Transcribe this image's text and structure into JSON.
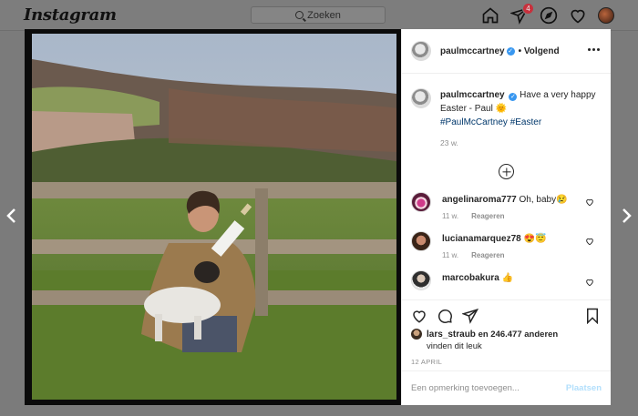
{
  "nav": {
    "logo": "Instagram",
    "search_placeholder": "Zoeken",
    "notification_count": "4",
    "icons": [
      "home-icon",
      "direct-icon",
      "explore-icon",
      "activity-heart-icon",
      "profile-avatar"
    ]
  },
  "post": {
    "author": "paulmccartney",
    "follow_label": "Volgend",
    "caption": {
      "username": "paulmccartney",
      "text": "Have a very happy Easter - Paul 🌞",
      "hashtags": "#PaulMcCartney #Easter",
      "time": "23 w."
    },
    "comments": [
      {
        "username": "angelinaroma777",
        "text": "Oh, baby😢",
        "time": "11 w.",
        "reply": "Reageren"
      },
      {
        "username": "lucianamarquez78",
        "text": "😍😇",
        "time": "11 w.",
        "reply": "Reageren"
      },
      {
        "username": "marcobakura",
        "text": "👍"
      }
    ],
    "likes": {
      "prefix_user": "lars_straub",
      "text": "en 246.477 anderen",
      "suffix": "vinden dit leuk"
    },
    "date": "12 APRIL",
    "add_comment_placeholder": "Een opmerking toevoegen...",
    "post_button": "Plaatsen"
  },
  "colors": {
    "overlay": "#7b7b7b",
    "link": "#00376b",
    "verified": "#3897f0",
    "post_disabled": "#b2dffc"
  }
}
